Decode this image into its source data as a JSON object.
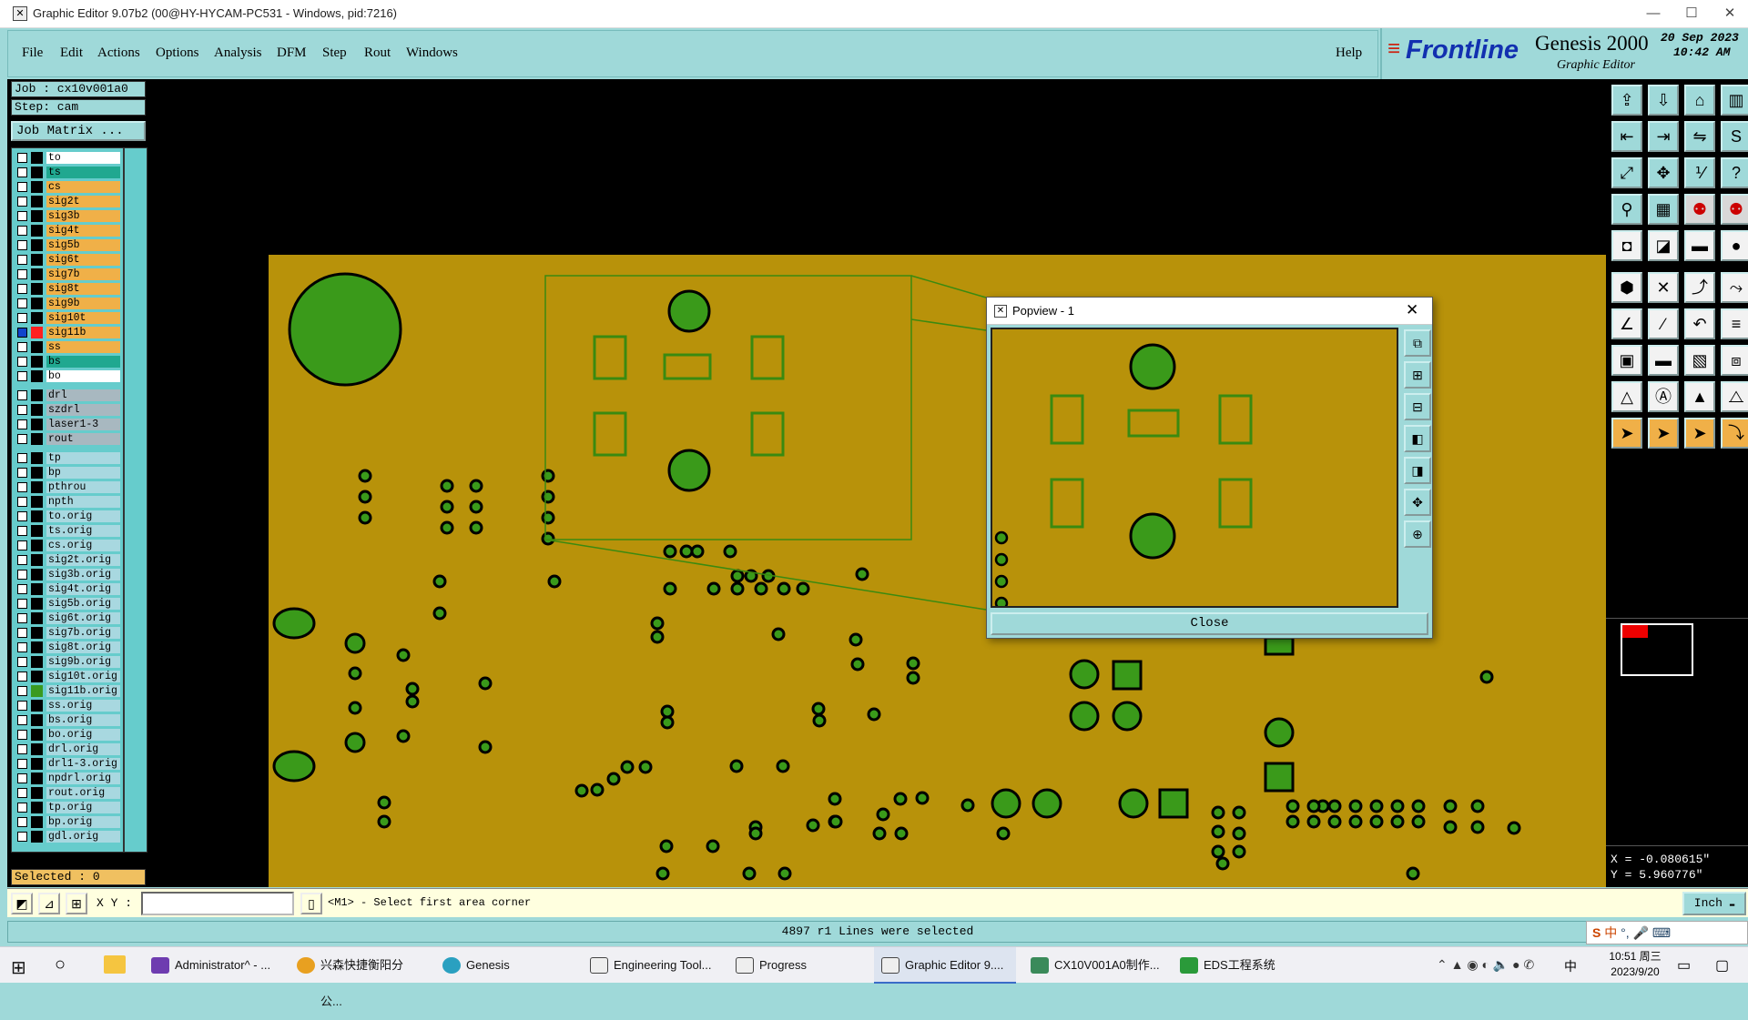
{
  "window": {
    "title": "Graphic Editor 9.07b2 (00@HY-HYCAM-PC531 - Windows, pid:7216)",
    "minimize": "—",
    "maximize": "☐",
    "close": "✕"
  },
  "menu": {
    "items": [
      "File",
      "Edit",
      "Actions",
      "Options",
      "Analysis",
      "DFM",
      "Step",
      "Rout",
      "Windows"
    ],
    "help": "Help"
  },
  "logo": {
    "brand": "Frontline",
    "product": "Genesis 2000",
    "subtitle": "Graphic Editor",
    "date_day": "20",
    "date_month": "Sep",
    "date_year": "2023",
    "time": "10:42",
    "ampm": "AM"
  },
  "job": {
    "job_label": "Job : cx10v001a0",
    "step_label": "Step: cam",
    "job_matrix": "Job Matrix ..."
  },
  "layers": [
    {
      "name": "to",
      "color": "#ffffff"
    },
    {
      "name": "ts",
      "color": "#20a890"
    },
    {
      "name": "cs",
      "color": "#f0b048"
    },
    {
      "name": "sig2t",
      "color": "#f0b048"
    },
    {
      "name": "sig3b",
      "color": "#f0b048"
    },
    {
      "name": "sig4t",
      "color": "#f0b048"
    },
    {
      "name": "sig5b",
      "color": "#f0b048"
    },
    {
      "name": "sig6t",
      "color": "#f0b048"
    },
    {
      "name": "sig7b",
      "color": "#f0b048"
    },
    {
      "name": "sig8t",
      "color": "#f0b048"
    },
    {
      "name": "sig9b",
      "color": "#f0b048"
    },
    {
      "name": "sig10t",
      "color": "#f0b048"
    },
    {
      "name": "sig11b",
      "color": "#f0b048",
      "checked": true,
      "swatch": "#ff2020",
      "marker": "■"
    },
    {
      "name": "ss",
      "color": "#f0b048"
    },
    {
      "name": "bs",
      "color": "#20a890"
    },
    {
      "name": "bo",
      "color": "#ffffff"
    },
    {
      "name": "drl",
      "color": "#a8b8c0",
      "gap": true
    },
    {
      "name": "szdrl",
      "color": "#a8b8c0"
    },
    {
      "name": "laser1-3",
      "color": "#a8b8c0"
    },
    {
      "name": "rout",
      "color": "#a8b8c0"
    },
    {
      "name": "tp",
      "color": "#a8d8e0",
      "gap": true
    },
    {
      "name": "bp",
      "color": "#a8d8e0"
    },
    {
      "name": "pthrou",
      "color": "#a8d8e0"
    },
    {
      "name": "npth",
      "color": "#a8d8e0"
    },
    {
      "name": "to.orig",
      "color": "#a8d8e0",
      "marker": "⸙"
    },
    {
      "name": "ts.orig",
      "color": "#a8d8e0"
    },
    {
      "name": "cs.orig",
      "color": "#a8d8e0"
    },
    {
      "name": "sig2t.orig",
      "color": "#a8d8e0"
    },
    {
      "name": "sig3b.orig",
      "color": "#a8d8e0"
    },
    {
      "name": "sig4t.orig",
      "color": "#a8d8e0"
    },
    {
      "name": "sig5b.orig",
      "color": "#a8d8e0"
    },
    {
      "name": "sig6t.orig",
      "color": "#a8d8e0"
    },
    {
      "name": "sig7b.orig",
      "color": "#a8d8e0"
    },
    {
      "name": "sig8t.orig",
      "color": "#a8d8e0"
    },
    {
      "name": "sig9b.orig",
      "color": "#a8d8e0"
    },
    {
      "name": "sig10t.orig",
      "color": "#a8d8e0"
    },
    {
      "name": "sig11b.orig",
      "color": "#a8d8e0",
      "swatch": "#3a9a20"
    },
    {
      "name": "ss.orig",
      "color": "#a8d8e0"
    },
    {
      "name": "bs.orig",
      "color": "#a8d8e0"
    },
    {
      "name": "bo.orig",
      "color": "#a8d8e0",
      "marker": "⸙"
    },
    {
      "name": "drl.orig",
      "color": "#a8d8e0"
    },
    {
      "name": "drl1-3.orig",
      "color": "#a8d8e0"
    },
    {
      "name": "npdrl.orig",
      "color": "#a8d8e0"
    },
    {
      "name": "rout.orig",
      "color": "#a8d8e0"
    },
    {
      "name": "tp.orig",
      "color": "#a8d8e0"
    },
    {
      "name": "bp.orig",
      "color": "#a8d8e0"
    },
    {
      "name": "gdl.orig",
      "color": "#a8d8e0"
    }
  ],
  "selected_label": "Selected : 0",
  "coordinates": {
    "x": "X = -0.080615\"",
    "y": "Y = 5.960776\""
  },
  "command": {
    "xy_label": "X Y :",
    "prompt": "<M1> - Select first area corner",
    "units": "Inch"
  },
  "status": "4897 r1 Lines were selected",
  "popview": {
    "title": "Popview - 1",
    "close_label": "Close"
  },
  "colors": {
    "board": "#b8920a",
    "pad": "#3a9a1a",
    "outline": "#3a8a10",
    "panel": "#9fd9d9"
  },
  "toolbar_icons": [
    "top-view-icon",
    "bottom-view-icon",
    "home-icon",
    "layout-icon",
    "zoom-left-icon",
    "zoom-right-icon",
    "mirror-icon",
    "snap-icon",
    "fit-icon",
    "center-icon",
    "ratio-icon",
    "query-icon",
    "measure-icon",
    "grid-icon",
    "pad-net-icon",
    "pad-net2-icon",
    "select-pad-icon",
    "draw-icon",
    "line-icon",
    "fill-icon",
    "node-icon",
    "cross-icon",
    "connect-icon",
    "link-icon",
    "angle-icon",
    "slash-icon",
    "arc-icon",
    "flip-icon",
    "rect-icon",
    "dash-icon",
    "window-icon",
    "group-icon",
    "triangle-icon",
    "a-shape-icon",
    "a-fill-icon",
    "a-outline-icon",
    "pointer-icon",
    "pointer2-icon",
    "pointer3-icon",
    "path-icon"
  ],
  "taskbar": {
    "items": [
      "Administrator^ - ...",
      "兴森快捷衡阳分公...",
      "Genesis",
      "Engineering Tool...",
      "Progress",
      "Graphic Editor 9....",
      "CX10V001A0制作...",
      "EDS工程系统"
    ],
    "time": "10:51 周三",
    "date": "2023/9/20",
    "ime": "中"
  }
}
